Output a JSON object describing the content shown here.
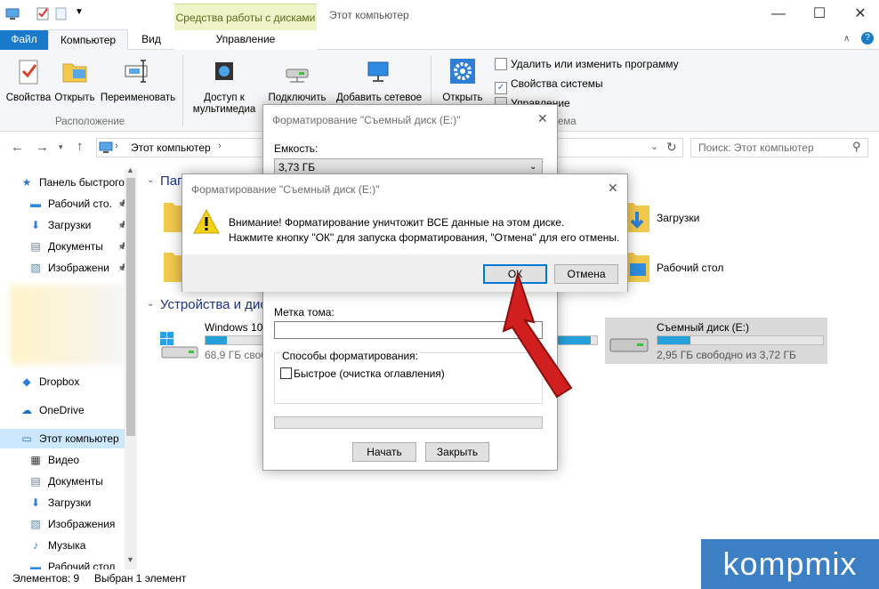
{
  "window": {
    "context_tab_group": "Средства работы с дисками",
    "title": "Этот компьютер",
    "minimize": "—",
    "maximize": "☐",
    "close": "✕"
  },
  "tabs": {
    "file": "Файл",
    "computer": "Компьютер",
    "view": "Вид",
    "manage": "Управление"
  },
  "ribbon": {
    "properties": "Свойства",
    "open": "Открыть",
    "rename": "Переименовать",
    "media_access": "Доступ к мультимедиа",
    "map_drive": "Подключить сетевой диск",
    "add_network": "Добавить сетевое",
    "open_params": "Открыть параметры",
    "uninstall": "Удалить или изменить программу",
    "sys_props": "Свойства системы",
    "manage": "Управление",
    "group_location": "Расположение",
    "group_system_suffix": "ема"
  },
  "address": {
    "path": "Этот компьютер",
    "search_placeholder": "Поиск: Этот компьютер"
  },
  "nav": [
    {
      "label": "Панель быстрого",
      "icon": "star-icon",
      "pinned": false
    },
    {
      "label": "Рабочий сто.",
      "icon": "desktop-folder-icon",
      "pinned": true
    },
    {
      "label": "Загрузки",
      "icon": "download-icon",
      "pinned": true
    },
    {
      "label": "Документы",
      "icon": "documents-icon",
      "pinned": true
    },
    {
      "label": "Изображени",
      "icon": "pictures-icon",
      "pinned": true
    },
    {
      "label": "Dropbox",
      "icon": "dropbox-icon",
      "pinned": false
    },
    {
      "label": "OneDrive",
      "icon": "onedrive-icon",
      "pinned": false
    },
    {
      "label": "Этот компьютер",
      "icon": "computer-icon",
      "pinned": false
    },
    {
      "label": "Видео",
      "icon": "video-icon",
      "pinned": false
    },
    {
      "label": "Документы",
      "icon": "documents-icon",
      "pinned": false
    },
    {
      "label": "Загрузки",
      "icon": "download-icon",
      "pinned": false
    },
    {
      "label": "Изображения",
      "icon": "pictures-icon",
      "pinned": false
    },
    {
      "label": "Музыка",
      "icon": "music-icon",
      "pinned": false
    },
    {
      "label": "Рабочий стол",
      "icon": "desktop-folder-icon",
      "pinned": false
    }
  ],
  "content": {
    "folders_header": "Папки",
    "devices_header": "Устройства и дис",
    "downloads": "Загрузки",
    "desktop": "Рабочий стол",
    "windows_drive": "Windows 10",
    "windows_free": "68,9 ГБ свобо",
    "windows_fill": 0.35,
    "removable_drive": "Съемный диск (E:)",
    "removable_free": "2,95 ГБ свободно из 3,72 ГБ",
    "removable_fill": 0.2,
    "mid_bar_fill": 0.85
  },
  "status": {
    "items": "Элементов: 9",
    "selected": "Выбран 1 элемент"
  },
  "format_dialog": {
    "title": "Форматирование \"Съемный диск (E:)\"",
    "capacity_label": "Емкость:",
    "capacity_value": "3,73 ГБ",
    "volume_label": "Метка тома:",
    "volume_value": "",
    "methods_label": "Способы форматирования:",
    "quick_label": "Быстрое (очистка оглавления)",
    "quick_checked": false,
    "progress": 0,
    "start": "Начать",
    "close": "Закрыть"
  },
  "warning_dialog": {
    "title": "Форматирование \"Съемный диск (E:)\"",
    "line1": "Внимание! Форматирование уничтожит ВСЕ данные на этом диске.",
    "line2": "Нажмите кнопку \"ОК\" для запуска форматирования, \"Отмена\" для его отмены.",
    "ok": "ОК",
    "cancel": "Отмена"
  },
  "watermark": "kompmix",
  "colors": {
    "accent": "#1979ca",
    "drive_bar": "#26a0da",
    "selection": "#cce8ff",
    "arrow": "#d11f1f"
  }
}
